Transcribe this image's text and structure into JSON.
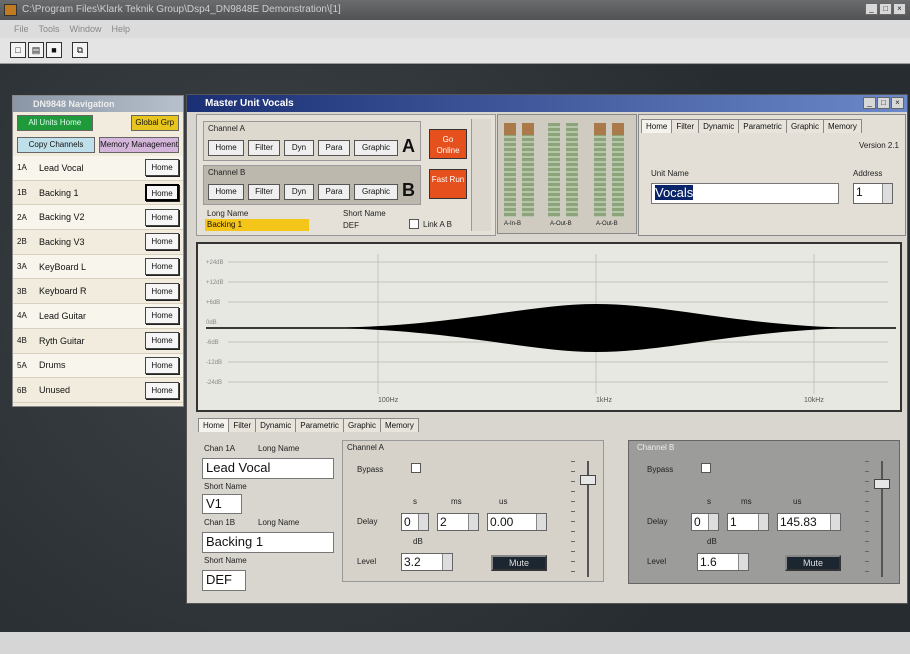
{
  "app": {
    "title": "C:\\Program Files\\Klark Teknik Group\\Dsp4_DN9848E Demonstration\\[1]",
    "menu": [
      "File",
      "Tools",
      "Window",
      "Help"
    ],
    "window_buttons": [
      "_",
      "□",
      "×"
    ]
  },
  "nav": {
    "title": "DN9848 Navigation",
    "buttons": {
      "all_units": "All Units Home",
      "global": "Global Grp",
      "copy": "Copy Channels",
      "memory": "Memory Management"
    },
    "rows": [
      {
        "id": "1A",
        "name": "Lead Vocal",
        "btn": "Home"
      },
      {
        "id": "1B",
        "name": "Backing 1",
        "btn": "Home"
      },
      {
        "id": "2A",
        "name": "Backing V2",
        "btn": "Home"
      },
      {
        "id": "2B",
        "name": "Backing V3",
        "btn": "Home"
      },
      {
        "id": "3A",
        "name": "KeyBoard L",
        "btn": "Home"
      },
      {
        "id": "3B",
        "name": "Keyboard R",
        "btn": "Home"
      },
      {
        "id": "4A",
        "name": "Lead Guitar",
        "btn": "Home"
      },
      {
        "id": "4B",
        "name": "Ryth Guitar",
        "btn": "Home"
      },
      {
        "id": "5A",
        "name": "Drums",
        "btn": "Home"
      },
      {
        "id": "6B",
        "name": "Unused",
        "btn": "Home"
      }
    ]
  },
  "master": {
    "title": "Master Unit Vocals",
    "window_buttons": [
      "_",
      "□",
      "×"
    ],
    "chA": {
      "label": "Channel A",
      "buttons": [
        "Home",
        "Filter",
        "Dyn",
        "Para",
        "Graphic"
      ],
      "letter": "A"
    },
    "chB": {
      "label": "Channel B",
      "buttons": [
        "Home",
        "Filter",
        "Dyn",
        "Para",
        "Graphic"
      ],
      "letter": "B"
    },
    "go_online": "Go Online",
    "fast_run": "Fast Run",
    "long_name_label": "Long Name",
    "long_name": "Backing 1",
    "short_name_label": "Short Name",
    "short_name": "DEF",
    "link_label": "Link A B",
    "meters": [
      "A-In-B",
      "A-Out-B",
      "A-Out-B"
    ],
    "tabs": [
      "Home",
      "Filter",
      "Dynamic",
      "Parametric",
      "Graphic",
      "Memory"
    ],
    "version": "Version 2.1",
    "unit_name_label": "Unit Name",
    "unit_name": "Vocals",
    "address_label": "Address",
    "address": "1",
    "graph": {
      "x_labels": [
        "100Hz",
        "1kHz",
        "10kHz"
      ],
      "y_labels": [
        "+24dB",
        "+12dB",
        "+6dB",
        "0dB",
        "-6dB",
        "-12dB",
        "-24dB"
      ]
    },
    "lower_tabs": [
      "Home",
      "Filter",
      "Dynamic",
      "Parametric",
      "Graphic",
      "Memory"
    ],
    "chan1a_label": "Chan 1A",
    "long_name_label2": "Long Name",
    "chan1a_long": "Lead Vocal",
    "short_label": "Short Name",
    "chan1a_short": "V1",
    "chan1b_label": "Chan 1B",
    "chan1b_long": "Backing 1",
    "chan1b_short": "DEF",
    "channelA": {
      "title": "Channel A",
      "bypass": "Bypass",
      "delay": "Delay",
      "units": [
        "s",
        "ms",
        "us"
      ],
      "d1": "0",
      "d2": "2",
      "d3": "0.00",
      "db": "dB",
      "level": "Level",
      "level_val": "3.2",
      "mute": "Mute"
    },
    "channelB": {
      "title": "Channel B",
      "bypass": "Bypass",
      "delay": "Delay",
      "units": [
        "s",
        "ms",
        "us"
      ],
      "d1": "0",
      "d2": "1",
      "d3": "145.83",
      "db": "dB",
      "level": "Level",
      "level_val": "1.6",
      "mute": "Mute"
    }
  }
}
